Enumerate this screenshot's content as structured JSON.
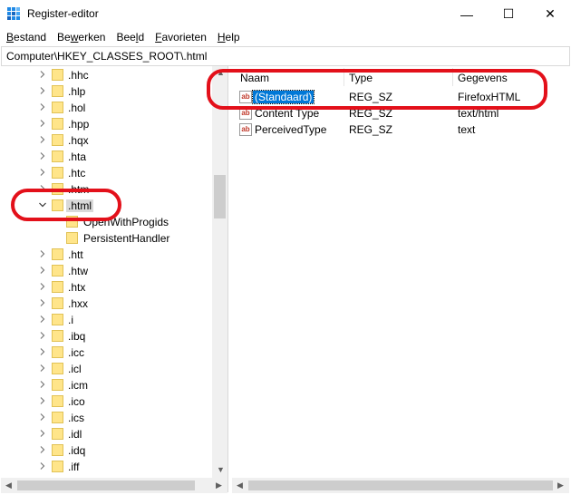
{
  "window": {
    "title": "Register-editor",
    "minimize": "—",
    "maximize": "☐",
    "close": "✕"
  },
  "menu": [
    {
      "accel": "B",
      "rest": "estand"
    },
    {
      "pre": "Be",
      "accel": "w",
      "rest": "erken"
    },
    {
      "pre": "Bee",
      "accel": "l",
      "rest": "d"
    },
    {
      "accel": "F",
      "rest": "avorieten"
    },
    {
      "accel": "H",
      "rest": "elp"
    }
  ],
  "address": "Computer\\HKEY_CLASSES_ROOT\\.html",
  "tree": {
    "items": [
      {
        "label": ".hhc"
      },
      {
        "label": ".hlp"
      },
      {
        "label": ".hol"
      },
      {
        "label": ".hpp"
      },
      {
        "label": ".hqx"
      },
      {
        "label": ".hta"
      },
      {
        "label": ".htc"
      },
      {
        "label": ".htm"
      },
      {
        "label": ".html"
      },
      {
        "label": "OpenWithProgids"
      },
      {
        "label": "PersistentHandler"
      },
      {
        "label": ".htt"
      },
      {
        "label": ".htw"
      },
      {
        "label": ".htx"
      },
      {
        "label": ".hxx"
      },
      {
        "label": ".i"
      },
      {
        "label": ".ibq"
      },
      {
        "label": ".icc"
      },
      {
        "label": ".icl"
      },
      {
        "label": ".icm"
      },
      {
        "label": ".ico"
      },
      {
        "label": ".ics"
      },
      {
        "label": ".idl"
      },
      {
        "label": ".idq"
      },
      {
        "label": ".iff"
      }
    ]
  },
  "values": {
    "headers": {
      "name": "Naam",
      "type": "Type",
      "data": "Gegevens"
    },
    "rows": [
      {
        "name": "(Standaard)",
        "type": "REG_SZ",
        "data": "FirefoxHTML"
      },
      {
        "name": "Content Type",
        "type": "REG_SZ",
        "data": "text/html"
      },
      {
        "name": "PerceivedType",
        "type": "REG_SZ",
        "data": "text"
      }
    ],
    "icon_text": "ab"
  },
  "colors": {
    "selection": "#0078d7",
    "annotation": "#e3101a",
    "folder": "#ffe58a"
  },
  "icons": [
    "app-icon",
    "chevron-right-icon",
    "chevron-down-icon",
    "folder-icon",
    "reg-string-icon"
  ]
}
